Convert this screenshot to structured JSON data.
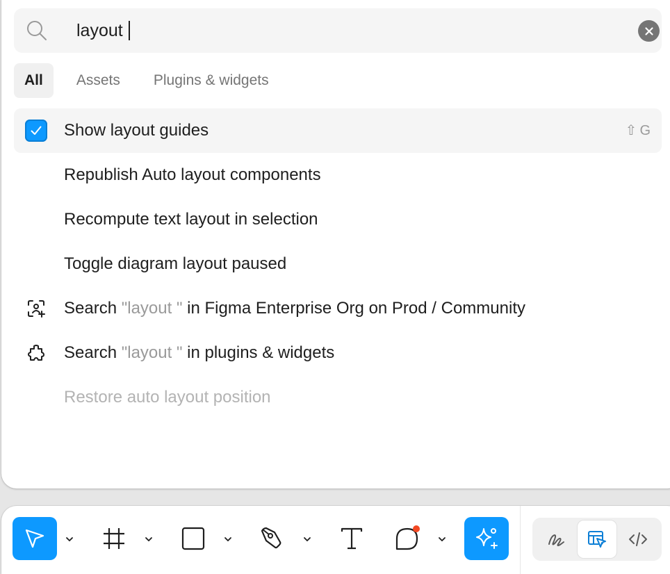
{
  "search": {
    "query": "layout",
    "clear_icon": "close-icon",
    "search_icon": "search-icon"
  },
  "tabs": [
    {
      "label": "All",
      "active": true
    },
    {
      "label": "Assets",
      "active": false
    },
    {
      "label": "Plugins & widgets",
      "active": false
    }
  ],
  "results": {
    "show_layout_guides": {
      "label": "Show layout guides",
      "checked": true,
      "shortcut_symbol": "⇧",
      "shortcut_key": "G"
    },
    "republish": {
      "label": "Republish Auto layout components"
    },
    "recompute": {
      "label": "Recompute text layout in selection"
    },
    "toggle": {
      "label": "Toggle diagram layout paused"
    },
    "search_community": {
      "prefix": "Search",
      "quoted": "\"layout \"",
      "suffix": "in Figma Enterprise Org on Prod / Community",
      "icon": "community-scan-icon"
    },
    "search_plugins": {
      "prefix": "Search",
      "quoted": "\"layout \"",
      "suffix": "in plugins & widgets",
      "icon": "plugin-puzzle-icon"
    },
    "restore": {
      "label": "Restore auto layout position",
      "disabled": true
    }
  },
  "toolbar": {
    "tools": [
      "move-tool",
      "frame-tool",
      "rectangle-tool",
      "pen-tool",
      "text-tool",
      "comment-tool",
      "ai-actions-tool"
    ],
    "modes": [
      "draw-mode",
      "design-mode",
      "dev-mode"
    ],
    "active_mode": "design-mode",
    "colors": {
      "accent": "#0d99ff",
      "notification": "#f24822"
    }
  }
}
